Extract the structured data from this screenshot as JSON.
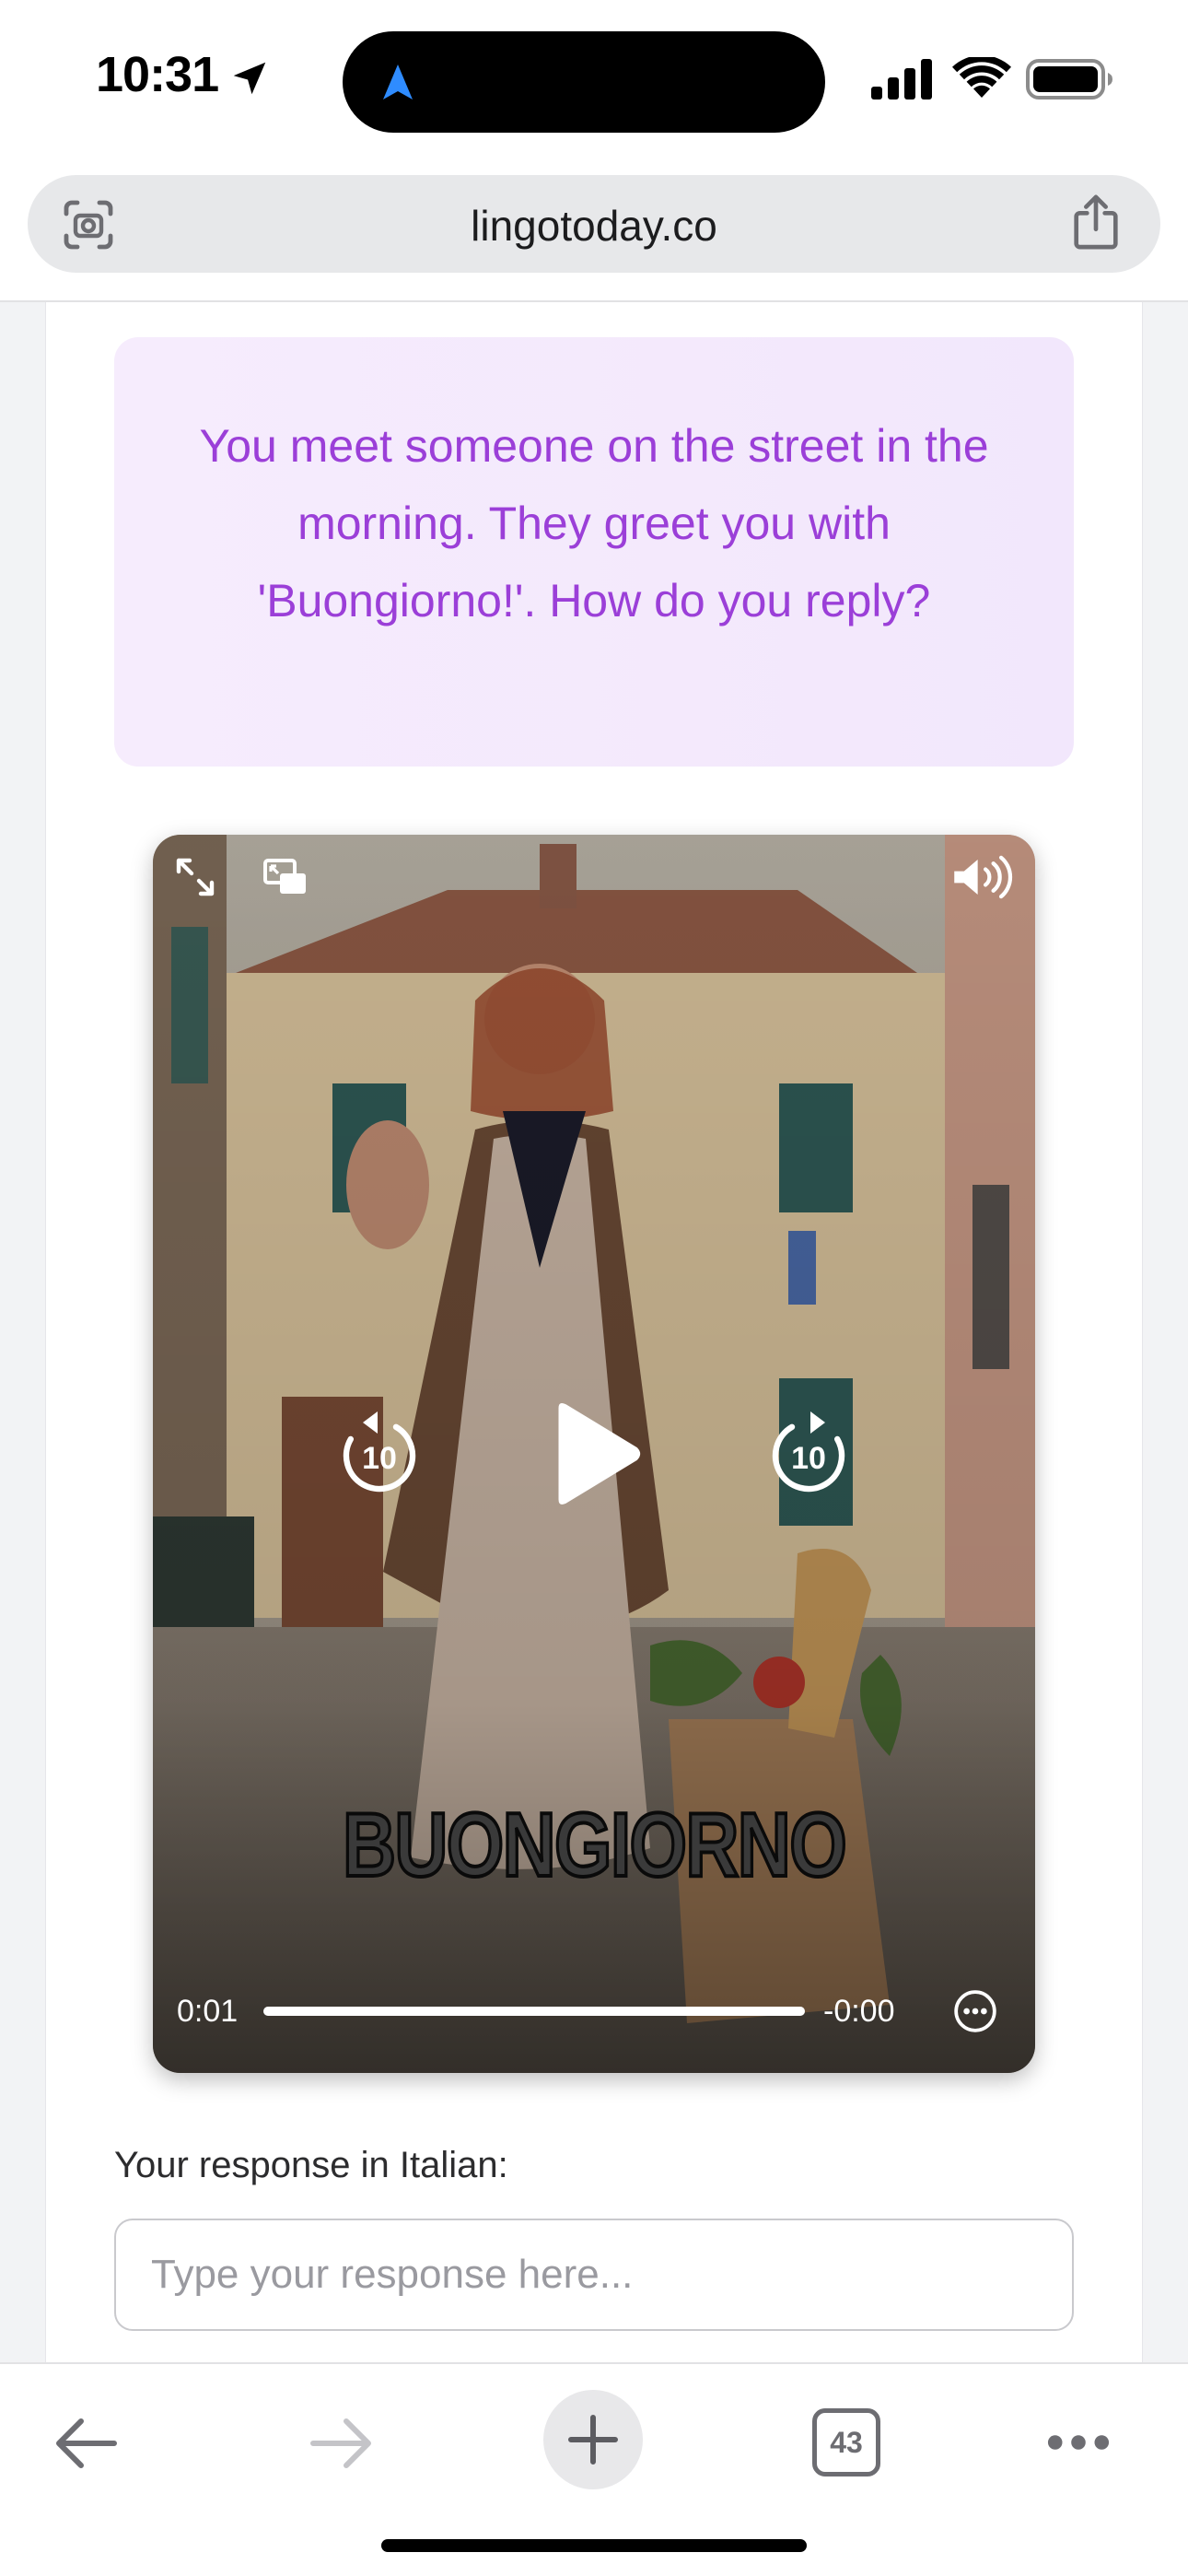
{
  "status_bar": {
    "time": "10:31",
    "icons": [
      "location-arrow-icon",
      "signal-icon",
      "wifi-icon",
      "battery-icon"
    ]
  },
  "browser": {
    "url": "lingotoday.co",
    "left_icon": "page-scan-icon",
    "right_icon": "share-icon"
  },
  "scenario": {
    "prompt": "You meet someone on the street in the morning. They greet you with 'Buongiorno!'. How do you reply?",
    "colors": {
      "prompt_text": "#9b3fd8",
      "prompt_bg": "#f4eafd"
    }
  },
  "video": {
    "caption": "BUONGIORNO",
    "elapsed": "0:01",
    "remaining": "-0:00",
    "progress": 1.0,
    "skip_back_label": "10",
    "skip_forward_label": "10",
    "controls": [
      "fullscreen-icon",
      "picture-in-picture-icon",
      "volume-icon",
      "skip-back-10-icon",
      "play-icon",
      "skip-forward-10-icon",
      "more-options-icon"
    ]
  },
  "response": {
    "label": "Your response in Italian:",
    "placeholder": "Type your response here...",
    "value": ""
  },
  "toolbar": {
    "tabs_count": "43",
    "icons": [
      "back-icon",
      "forward-icon",
      "new-tab-icon",
      "tabs-icon",
      "more-icon"
    ]
  }
}
